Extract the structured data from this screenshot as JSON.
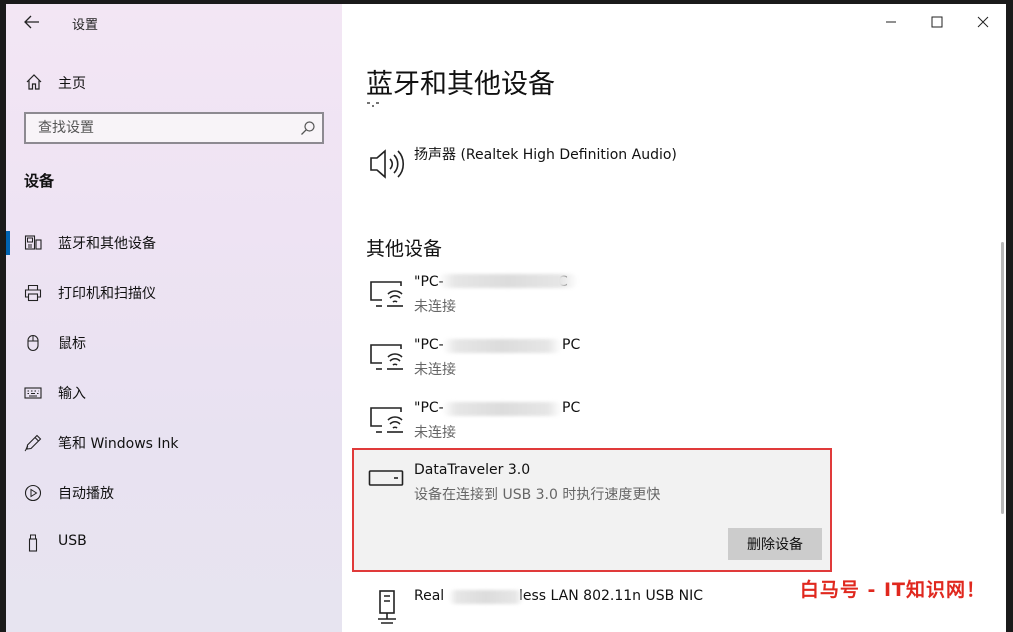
{
  "window": {
    "app_title": "设置"
  },
  "sidebar": {
    "home_label": "主页",
    "search_placeholder": "查找设置",
    "section_title": "设备",
    "items": [
      {
        "label": "蓝牙和其他设备",
        "icon": "bluetooth-devices-icon",
        "active": true
      },
      {
        "label": "打印机和扫描仪",
        "icon": "printer-icon",
        "active": false
      },
      {
        "label": "鼠标",
        "icon": "mouse-icon",
        "active": false
      },
      {
        "label": "输入",
        "icon": "keyboard-icon",
        "active": false
      },
      {
        "label": "笔和 Windows Ink",
        "icon": "pen-icon",
        "active": false
      },
      {
        "label": "自动播放",
        "icon": "autoplay-icon",
        "active": false
      },
      {
        "label": "USB",
        "icon": "usb-icon",
        "active": false
      }
    ]
  },
  "main": {
    "title": "蓝牙和其他设备",
    "audio_devices": [
      {
        "name": "扬声器 (Realtek High Definition Audio)",
        "icon": "speaker-icon"
      }
    ],
    "other_devices_heading": "其他设备",
    "other_devices": [
      {
        "name_start": "\"PC-",
        "name_end": "C",
        "status": "未连接",
        "icon": "network-display-icon"
      },
      {
        "name_start": "\"PC-",
        "name_end": "PC",
        "status": "未连接",
        "icon": "network-display-icon"
      },
      {
        "name_start": "\"PC-",
        "name_end": "PC",
        "status": "未连接",
        "icon": "network-display-icon"
      }
    ],
    "selected_device": {
      "name": "DataTraveler 3.0",
      "status": "设备在连接到 USB 3.0 时执行速度更快",
      "remove_label": "删除设备",
      "icon": "usb-drive-icon"
    },
    "last_device": {
      "name_start": "Real",
      "name_end": "less LAN 802.11n USB NIC",
      "icon": "network-adapter-icon"
    }
  },
  "watermark": "白马号 - IT知识网！",
  "colors": {
    "accent": "#0063b1",
    "highlight_border": "#e03a3a",
    "watermark": "#e0281e"
  }
}
